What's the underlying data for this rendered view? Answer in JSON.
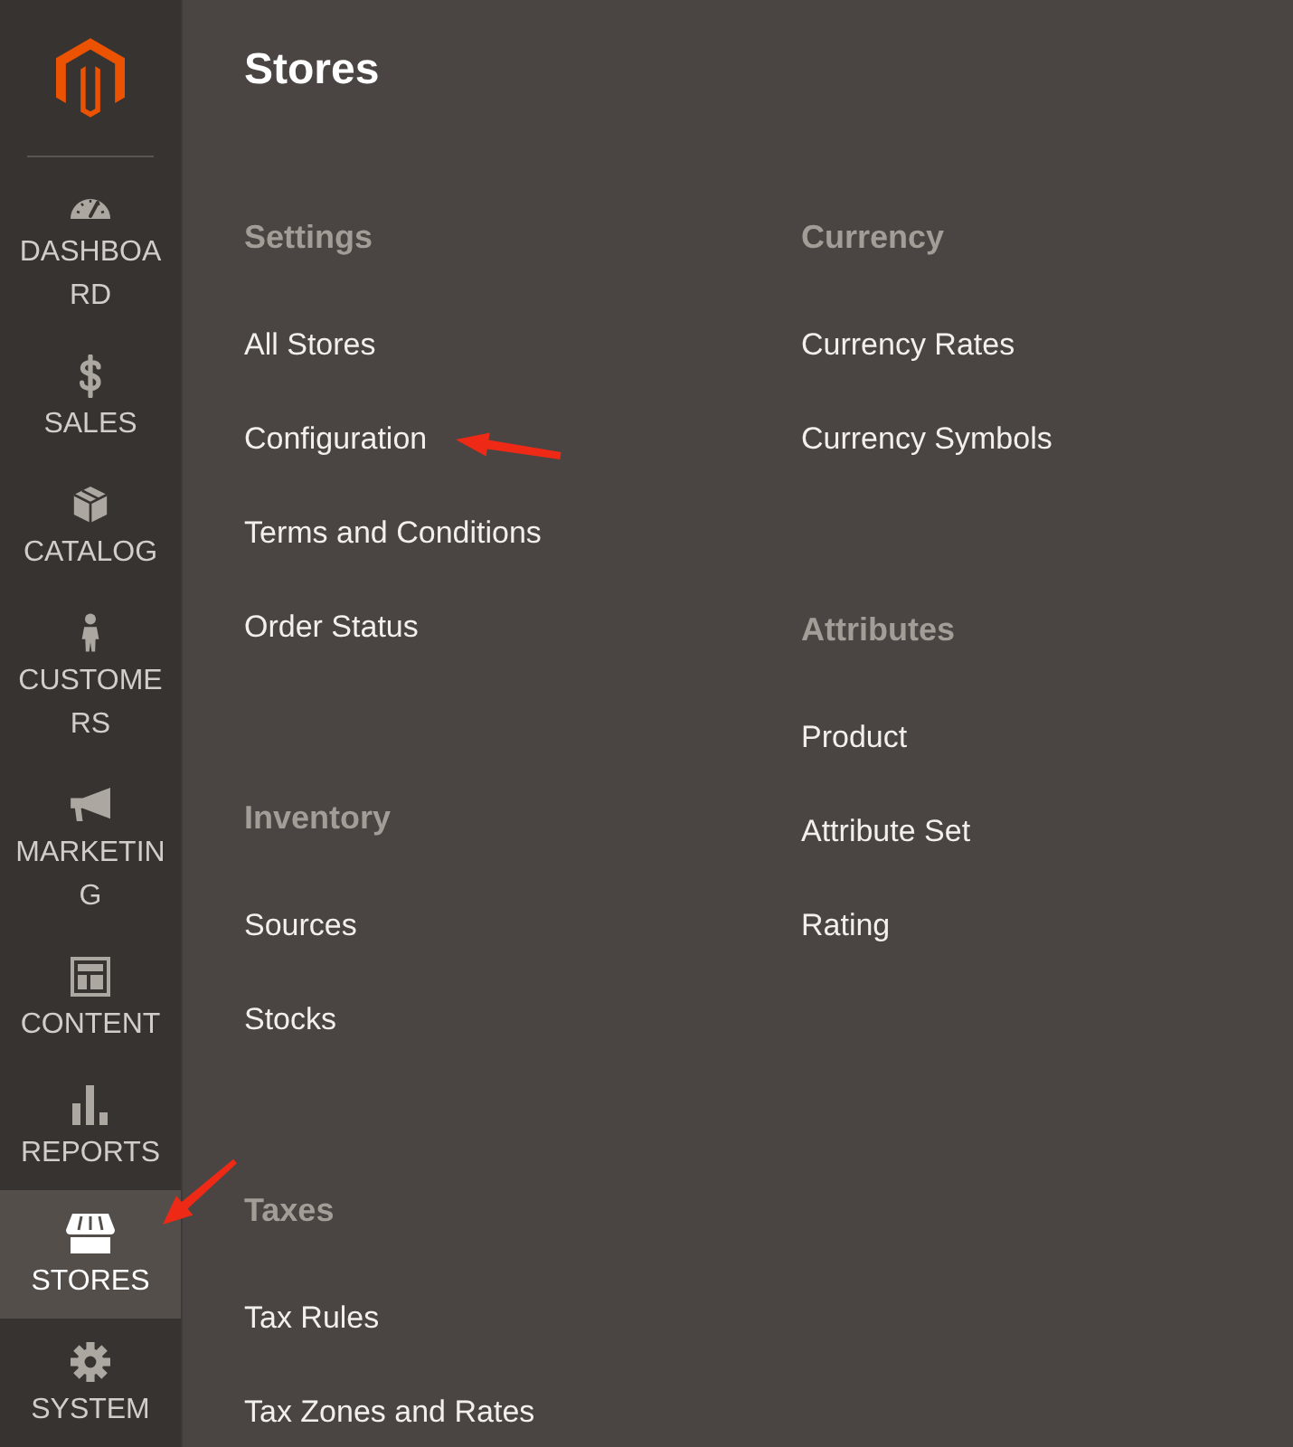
{
  "sidebar": {
    "items": [
      {
        "label": "DASHBOARD",
        "selected": false
      },
      {
        "label": "SALES",
        "selected": false
      },
      {
        "label": "CATALOG",
        "selected": false
      },
      {
        "label": "CUSTOMERS",
        "selected": false
      },
      {
        "label": "MARKETING",
        "selected": false
      },
      {
        "label": "CONTENT",
        "selected": false
      },
      {
        "label": "REPORTS",
        "selected": false
      },
      {
        "label": "STORES",
        "selected": true
      },
      {
        "label": "SYSTEM",
        "selected": false
      }
    ]
  },
  "panel": {
    "title": "Stores",
    "columns": [
      {
        "sections": [
          {
            "heading": "Settings",
            "links": [
              "All Stores",
              "Configuration",
              "Terms and Conditions",
              "Order Status"
            ]
          },
          {
            "heading": "Inventory",
            "links": [
              "Sources",
              "Stocks"
            ]
          },
          {
            "heading": "Taxes",
            "links": [
              "Tax Rules",
              "Tax Zones and Rates"
            ]
          }
        ]
      },
      {
        "sections": [
          {
            "heading": "Currency",
            "links": [
              "Currency Rates",
              "Currency Symbols"
            ]
          },
          {
            "heading": "Attributes",
            "links": [
              "Product",
              "Attribute Set",
              "Rating"
            ]
          }
        ]
      }
    ]
  }
}
